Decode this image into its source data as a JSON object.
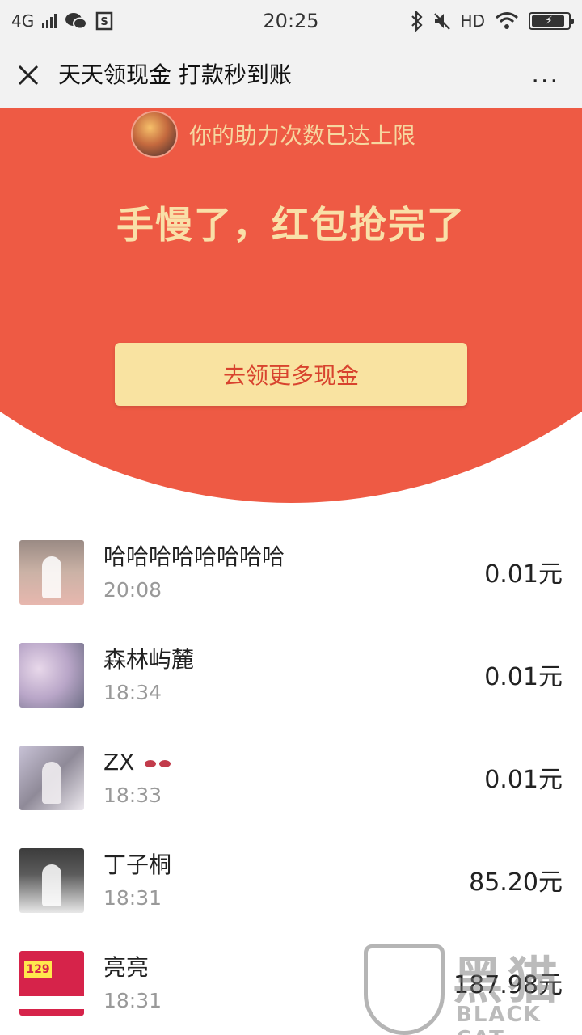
{
  "status_bar": {
    "network": "4G",
    "time": "20:25",
    "hd": "HD"
  },
  "nav": {
    "title": "天天领现金 打款秒到账",
    "more": "..."
  },
  "header": {
    "helper_text": "你的助力次数已达上限",
    "headline": "手慢了，红包抢完了",
    "cta_label": "去领更多现金"
  },
  "records": [
    {
      "name": "哈哈哈哈哈哈哈哈",
      "time": "20:08",
      "amount": "0.01元"
    },
    {
      "name": "森林屿麓",
      "time": "18:34",
      "amount": "0.01元"
    },
    {
      "name": "ZX",
      "time": "18:33",
      "amount": "0.01元"
    },
    {
      "name": "丁子桐",
      "time": "18:31",
      "amount": "85.20元"
    },
    {
      "name": "亮亮",
      "time": "18:31",
      "amount": "187.98元"
    }
  ],
  "avatar5_badge": "129",
  "watermark": {
    "cn": "黑猫",
    "en": "BLACK CAT"
  },
  "colors": {
    "red": "#ee5a44",
    "button_bg": "#f9e3a1",
    "button_text": "#d8432e",
    "headline": "#f9e0a8"
  }
}
